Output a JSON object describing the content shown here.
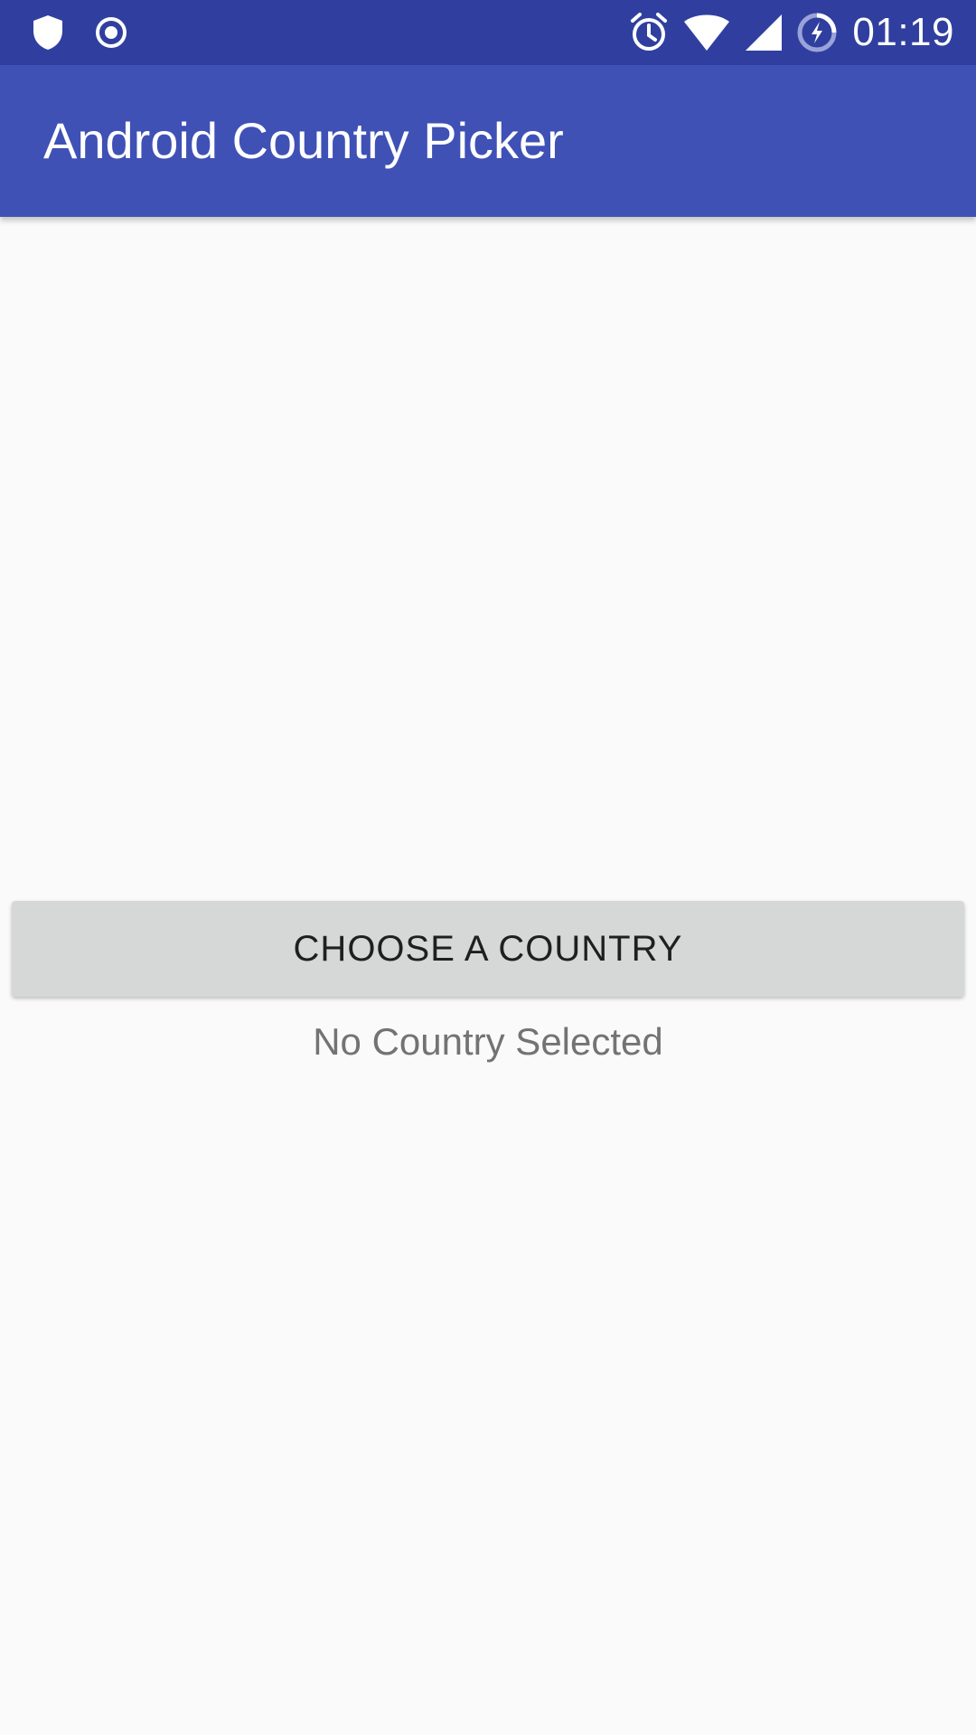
{
  "status_bar": {
    "time": "01:19",
    "icons_left": [
      "shield-icon",
      "record-icon"
    ],
    "icons_right": [
      "alarm-icon",
      "wifi-icon",
      "cell-signal-icon",
      "battery-charging-icon"
    ]
  },
  "app_bar": {
    "title": "Android Country Picker"
  },
  "main": {
    "choose_button_label": "CHOOSE A COUNTRY",
    "selection_status": "No Country Selected"
  },
  "colors": {
    "status_bar": "#303f9f",
    "app_bar": "#3f51b5",
    "background": "#fafafa",
    "button_background": "#d6d7d7"
  }
}
